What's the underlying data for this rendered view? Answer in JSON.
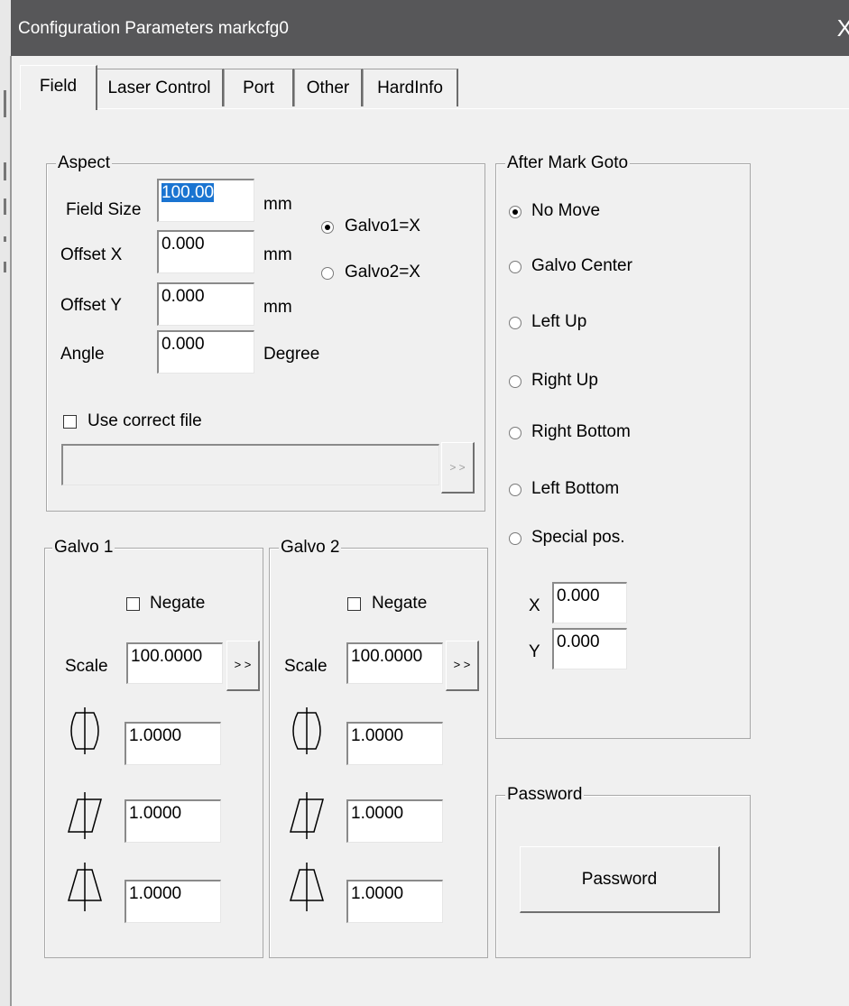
{
  "window": {
    "title": "Configuration Parameters markcfg0",
    "close_glyph": "X"
  },
  "tabs": [
    {
      "label": "Field",
      "active": true
    },
    {
      "label": "Laser Control",
      "active": false
    },
    {
      "label": "Port",
      "active": false
    },
    {
      "label": "Other",
      "active": false
    },
    {
      "label": "HardInfo",
      "active": false
    }
  ],
  "aspect": {
    "legend": "Aspect",
    "field_size": {
      "label": "Field Size",
      "value": "100.00",
      "unit": "mm"
    },
    "offset_x": {
      "label": "Offset X",
      "value": "0.000",
      "unit": "mm"
    },
    "offset_y": {
      "label": "Offset Y",
      "value": "0.000",
      "unit": "mm"
    },
    "angle": {
      "label": "Angle",
      "value": "0.000",
      "unit": "Degree"
    },
    "galvo1_x": {
      "label": "Galvo1=X",
      "selected": true
    },
    "galvo2_x": {
      "label": "Galvo2=X",
      "selected": false
    },
    "use_correct_file": {
      "label": "Use correct file",
      "checked": false
    },
    "correct_file_path": "",
    "browse_label": "> >"
  },
  "galvo1": {
    "legend": "Galvo 1",
    "negate_label": "Negate",
    "negate_checked": false,
    "scale_label": "Scale",
    "scale_value": "100.0000",
    "scale_button": "> >",
    "barrel_value": "1.0000",
    "parallelogram_value": "1.0000",
    "trapezoid_value": "1.0000",
    "icons": [
      "barrel-distortion-icon",
      "parallelogram-distortion-icon",
      "trapezoid-distortion-icon"
    ]
  },
  "galvo2": {
    "legend": "Galvo 2",
    "negate_label": "Negate",
    "negate_checked": false,
    "scale_label": "Scale",
    "scale_value": "100.0000",
    "scale_button": "> >",
    "barrel_value": "1.0000",
    "parallelogram_value": "1.0000",
    "trapezoid_value": "1.0000"
  },
  "after_mark": {
    "legend": "After Mark Goto",
    "options": [
      {
        "label": "No Move",
        "selected": true
      },
      {
        "label": "Galvo Center",
        "selected": false
      },
      {
        "label": "Left Up",
        "selected": false
      },
      {
        "label": "Right Up",
        "selected": false
      },
      {
        "label": "Right Bottom",
        "selected": false
      },
      {
        "label": "Left Bottom",
        "selected": false
      },
      {
        "label": "Special pos.",
        "selected": false
      }
    ],
    "x_label": "X",
    "x_value": "0.000",
    "y_label": "Y",
    "y_value": "0.000"
  },
  "password": {
    "legend": "Password",
    "button_label": "Password"
  },
  "colors": {
    "titlebar": "#575759",
    "background": "#f0f0f0",
    "selection": "#1a74d1"
  }
}
